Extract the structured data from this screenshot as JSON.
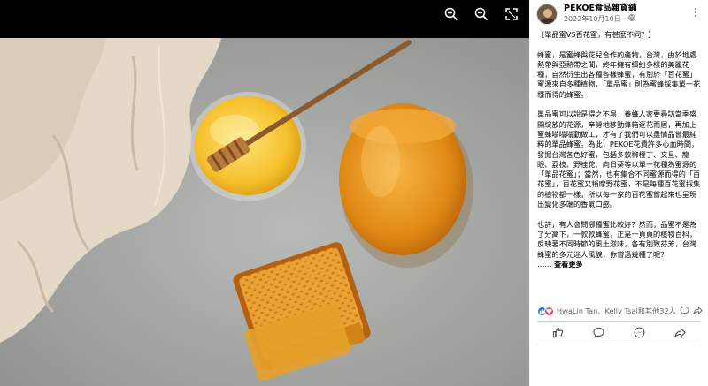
{
  "page": {
    "name": "PEKOE食品雜貨鋪",
    "date": "2022年10月10日",
    "dot": "·"
  },
  "post": {
    "title": "【單品蜜VS百花蜜，有甚麼不同？】",
    "para1": "蜂蜜，是蜜蜂與花兒合作的產物，台灣，由於地處熱帶與亞熱帶之間，終年擁有繽紛多樣的美麗花種，自然衍生出各種各樣蜂蜜，有別於「百花蜜」蜜源來自多種植物，「單品蜜」則為蜜蜂採集單一花種而得的蜂蜜。",
    "para2": "單品蜜可以說是得之不易，養蜂人家要尋訪當季盛開綻放的花源，辛勞地移動蜂箱逐花而居，再加上蜜蜂嗡嗡嗡勤做工，才有了我們可以盡情品嘗最純粹的單品蜂蜜。為此，PEKOE花費許多心血時間，發掘台灣各色好蜜，包括多款柳橙丁、文旦、龍眼、荔枝、野桂花、向日葵等以單一花種為蜜源的「單品花蜜」；當然，也有集合不同蜜源而得的「百花蜜」，百花蜜又稱摩野花蜜，不是每種百花蜜採集的植物都一樣，所以每一家的百花蜜嘗起來也呈現出變化多端的香氣口感。",
    "para3": "也許，有人會問哪種蜜比較好？然而，品蜜不是為了分高下，一款款蜂蜜，正是一頁頁的植物百科，反映著不同時節的風土滋味，各有別致芬芳，台灣蜂蜜的多元迷人風貌，你嘗過幾種了呢？",
    "ellipsis": "……",
    "see_more": "查看更多"
  },
  "reactions": {
    "text": "HwaLin Tan、Kelly Tsai和其他32人"
  },
  "icons": {
    "zoom_in": "zoom-in-icon",
    "zoom_out": "zoom-out-icon",
    "fullscreen": "fullscreen-icon",
    "globe": "globe-icon",
    "more": "more-icon",
    "like": "like-icon",
    "comment": "comment-icon",
    "share": "share-icon",
    "send": "send-icon"
  },
  "colors": {
    "facebook_blue": "#1877f2",
    "love_red": "#f33e58",
    "meta_gray": "#65676b"
  }
}
